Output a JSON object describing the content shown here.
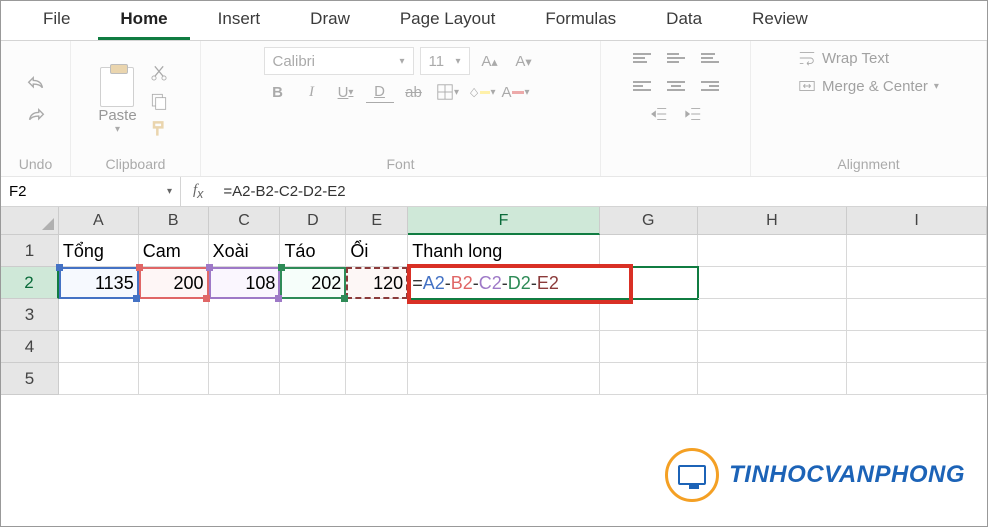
{
  "tabs": [
    "File",
    "Home",
    "Insert",
    "Draw",
    "Page Layout",
    "Formulas",
    "Data",
    "Review"
  ],
  "active_tab": "Home",
  "groups": {
    "undo": "Undo",
    "clipboard": "Clipboard",
    "paste": "Paste",
    "font": "Font",
    "alignment": "Alignment"
  },
  "font": {
    "name": "Calibri",
    "size": "11"
  },
  "align": {
    "wrap": "Wrap Text",
    "merge": "Merge & Center"
  },
  "name_box": "F2",
  "formula_bar": "=A2-B2-C2-D2-E2",
  "columns": [
    "A",
    "B",
    "C",
    "D",
    "E",
    "F",
    "G",
    "H",
    "I"
  ],
  "row_labels": [
    "1",
    "2",
    "3",
    "4",
    "5"
  ],
  "headers": {
    "A": "Tổng",
    "B": "Cam",
    "C": "Xoài",
    "D": "Táo",
    "E": "Ổi",
    "F": "Thanh long"
  },
  "data_row2": {
    "A": "1135",
    "B": "200",
    "C": "108",
    "D": "202",
    "E": "120"
  },
  "formula_tokens": {
    "eq": "=",
    "A": "A2",
    "B": "B2",
    "C": "C2",
    "D": "D2",
    "E": "E2",
    "op": "-"
  },
  "watermark": "TINHOCVANPHONG"
}
